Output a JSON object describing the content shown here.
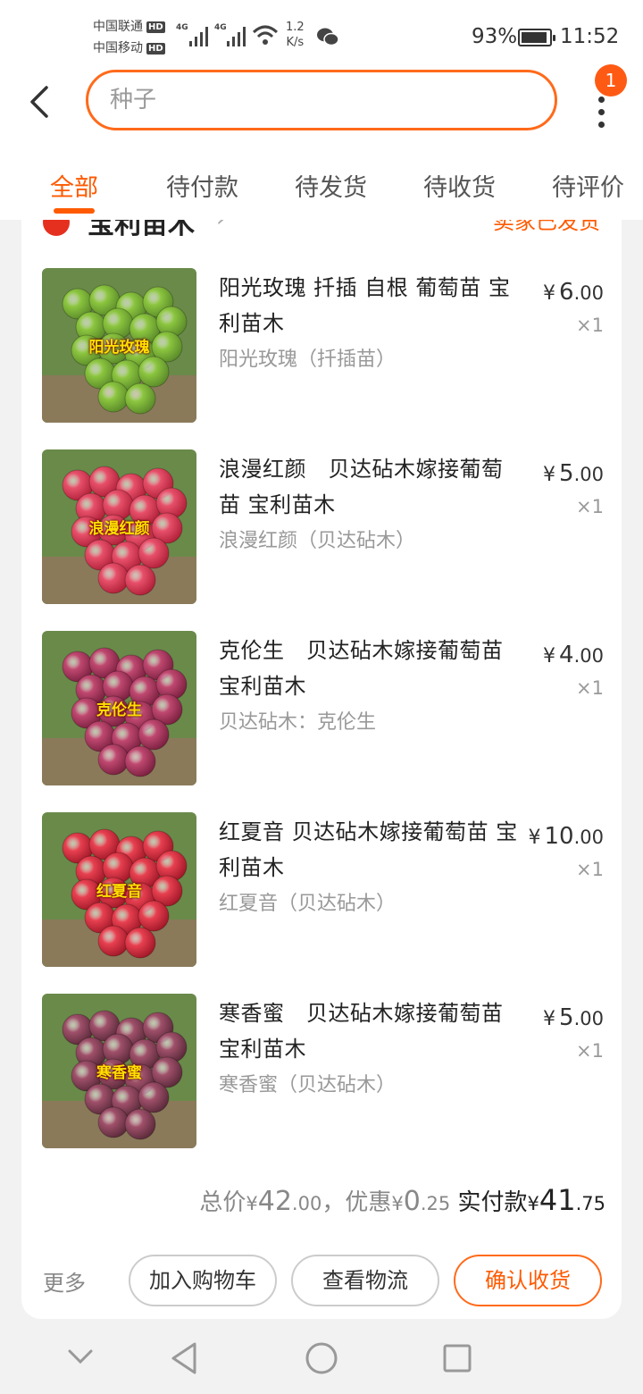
{
  "status_bar": {
    "carrier1": "中国联通",
    "carrier2": "中国移动",
    "hd": "HD",
    "net": "4G",
    "speed_value": "1.2",
    "speed_unit": "K/s",
    "battery": "93%",
    "battery_level": 0.93,
    "time": "11:52"
  },
  "header": {
    "search_value": "种子",
    "notification_count": "1"
  },
  "tabs": [
    {
      "label": "全部"
    },
    {
      "label": "待付款"
    },
    {
      "label": "待发货"
    },
    {
      "label": "待收货"
    },
    {
      "label": "待评价"
    }
  ],
  "order": {
    "shop_name": "宝利苗木",
    "status": "卖家已发货",
    "items": [
      {
        "title": "阳光玫瑰  扦插  自根  葡萄苗 宝利苗木",
        "sku": "阳光玫瑰（扦插苗）",
        "price_int": "6",
        "price_dec": ".00",
        "qty": "×1",
        "thumb_label": "阳光玫瑰",
        "color_a": "#8cc63f",
        "color_b": "#5a8a2a"
      },
      {
        "title": "浪漫红颜　贝达砧木嫁接葡萄苗  宝利苗木",
        "sku": "浪漫红颜（贝达砧木）",
        "price_int": "5",
        "price_dec": ".00",
        "qty": "×1",
        "thumb_label": "浪漫红颜",
        "color_a": "#e8506a",
        "color_b": "#b02038"
      },
      {
        "title": "克伦生　贝达砧木嫁接葡萄苗  宝利苗木",
        "sku": "贝达砧木：克伦生",
        "price_int": "4",
        "price_dec": ".00",
        "qty": "×1",
        "thumb_label": "克伦生",
        "color_a": "#c04870",
        "color_b": "#7a2040"
      },
      {
        "title": "红夏音  贝达砧木嫁接葡萄苗  宝利苗木",
        "sku": "红夏音（贝达砧木）",
        "price_int": "10",
        "price_dec": ".00",
        "qty": "×1",
        "thumb_label": "红夏音",
        "color_a": "#e84050",
        "color_b": "#a01828"
      },
      {
        "title": "寒香蜜　贝达砧木嫁接葡萄苗  宝利苗木",
        "sku": "寒香蜜（贝达砧木）",
        "price_int": "5",
        "price_dec": ".00",
        "qty": "×1",
        "thumb_label": "寒香蜜",
        "color_a": "#a0506a",
        "color_b": "#5a2a3a"
      }
    ],
    "summary": {
      "total_label": "总价",
      "total_int": "42",
      "total_dec": ".00",
      "discount_label": "，优惠",
      "discount_int": "0",
      "discount_dec": ".25",
      "paid_label": "实付款",
      "paid_int": "41",
      "paid_dec": ".75",
      "currency": "¥"
    },
    "actions": {
      "more": "更多",
      "add_to_cart": "加入购物车",
      "view_logistics": "查看物流",
      "confirm_receipt": "确认收货"
    }
  },
  "colors": {
    "accent": "#ff5a00",
    "background": "#f2f2f2"
  }
}
